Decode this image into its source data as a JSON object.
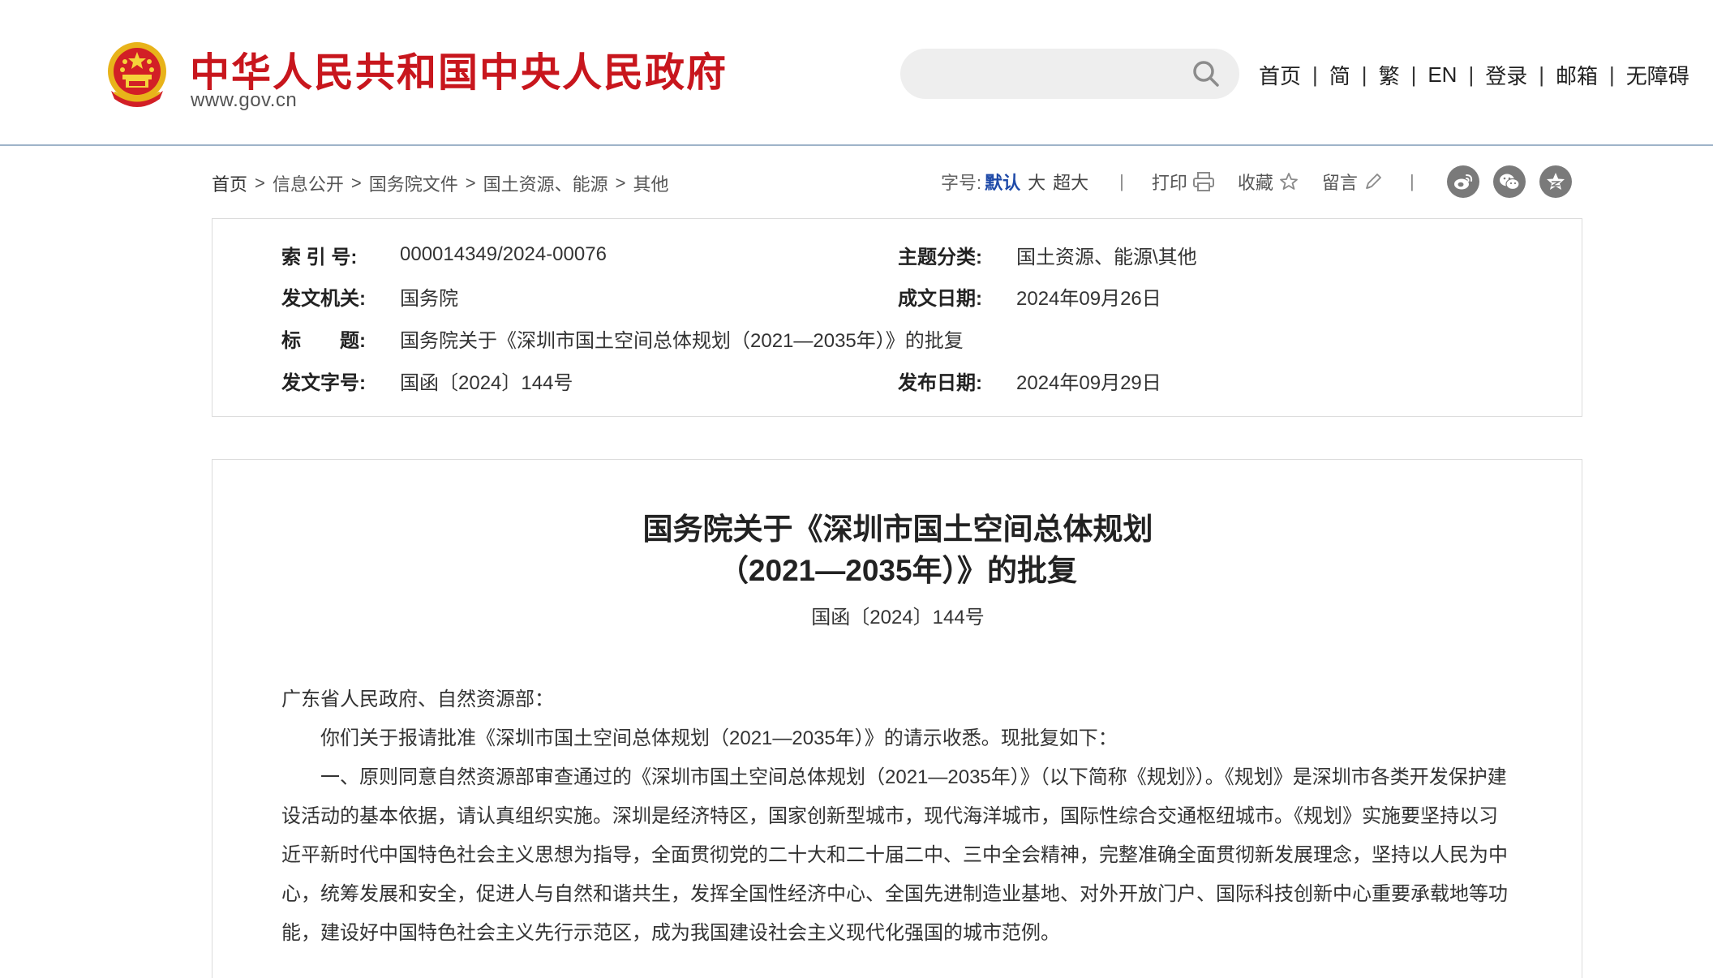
{
  "header": {
    "site_name": "中华人民共和国中央人民政府",
    "site_domain": "www.gov.cn",
    "search_placeholder": "",
    "nav": [
      "首页",
      "简",
      "繁",
      "EN",
      "登录",
      "邮箱",
      "无障碍"
    ]
  },
  "breadcrumb": [
    "首页",
    "信息公开",
    "国务院文件",
    "国土资源、能源",
    "其他"
  ],
  "tools": {
    "font_size_label": "字号:",
    "font_default": "默认",
    "font_large": "大",
    "font_xlarge": "超大",
    "print": "打印",
    "favorite": "收藏",
    "comment": "留言",
    "share_icons": [
      "weibo-icon",
      "wechat-icon",
      "qzone-icon"
    ]
  },
  "info": {
    "index_label": "索 引 号:",
    "index_value": "000014349/2024-00076",
    "topic_label": "主题分类:",
    "topic_value": "国土资源、能源\\其他",
    "issuer_label": "发文机关:",
    "issuer_value": "国务院",
    "created_label": "成文日期:",
    "created_value": "2024年09月26日",
    "title_label": "标　　题:",
    "title_value": "国务院关于《深圳市国土空间总体规划（2021—2035年）》的批复",
    "docno_label": "发文字号:",
    "docno_value": "国函〔2024〕144号",
    "published_label": "发布日期:",
    "published_value": "2024年09月29日"
  },
  "article": {
    "title_line1": "国务院关于《深圳市国土空间总体规划",
    "title_line2": "（2021—2035年）》的批复",
    "doc_number": "国函〔2024〕144号",
    "salutation": "广东省人民政府、自然资源部：",
    "paragraphs": [
      "你们关于报请批准《深圳市国土空间总体规划（2021—2035年）》的请示收悉。现批复如下：",
      "一、原则同意自然资源部审查通过的《深圳市国土空间总体规划（2021—2035年）》（以下简称《规划》）。《规划》是深圳市各类开发保护建设活动的基本依据，请认真组织实施。深圳是经济特区，国家创新型城市，现代海洋城市，国际性综合交通枢纽城市。《规划》实施要坚持以习近平新时代中国特色社会主义思想为指导，全面贯彻党的二十大和二十届二中、三中全会精神，完整准确全面贯彻新发展理念，坚持以人民为中心，统筹发展和安全，促进人与自然和谐共生，发挥全国性经济中心、全国先进制造业基地、对外开放门户、国际科技创新中心重要承载地等功能，建设好中国特色社会主义先行示范区，成为我国建设社会主义现代化强国的城市范例。"
    ]
  },
  "colors": {
    "brand_red": "#c8161d",
    "link_blue": "#1f4aa8",
    "header_rule": "#9fb4c9",
    "emblem_gold": "#e8b31a"
  }
}
